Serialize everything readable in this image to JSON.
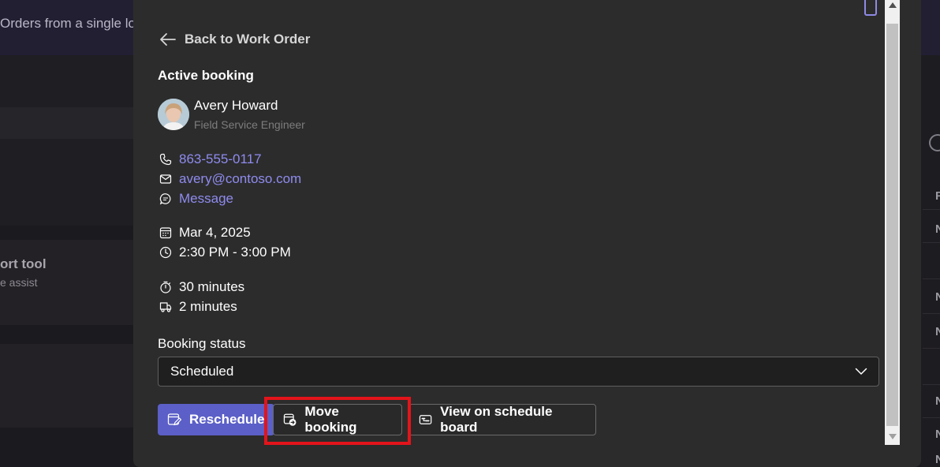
{
  "background": {
    "top_text": "Orders from a single lo",
    "card_title": "ort tool",
    "card_subtitle": "e assist",
    "right_letters": [
      "F",
      "N",
      "N",
      "N",
      "N",
      "N",
      "N"
    ]
  },
  "dialog": {
    "back_label": "Back to Work Order",
    "section_title": "Active booking",
    "person": {
      "name": "Avery Howard",
      "role": "Field Service Engineer"
    },
    "contact": {
      "phone": "863-555-0117",
      "email": "avery@contoso.com",
      "message": "Message"
    },
    "schedule": {
      "date": "Mar 4, 2025",
      "time": "2:30 PM - 3:00 PM",
      "duration": "30 minutes",
      "travel": "2 minutes"
    },
    "status": {
      "label": "Booking status",
      "value": "Scheduled"
    },
    "actions": {
      "reschedule": "Reschedule",
      "move": "Move booking",
      "view_board": "View on schedule board"
    }
  },
  "colors": {
    "accent": "#5b5fc7",
    "link": "#8f8bef",
    "highlight": "#e3141b"
  }
}
